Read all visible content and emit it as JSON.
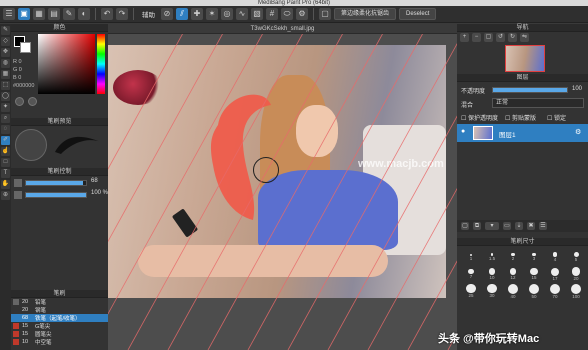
{
  "window": {
    "title": "MediBang Paint Pro (64bit)"
  },
  "toolbar": {
    "assist_label": "辅助",
    "antialias_button": "第边缘柔化抗锯齿",
    "deselect_button": "Deselect"
  },
  "document": {
    "tab_title": "T3wGKcSekh_small.jpg"
  },
  "color_panel": {
    "title": "颜色",
    "r_label": "R 0",
    "g_label": "G 0",
    "b_label": "B 0",
    "hex_label": "#000000"
  },
  "brush_preview_panel": {
    "title": "笔刷预览"
  },
  "brush_control_panel": {
    "title": "笔刷控制",
    "size_value": "68",
    "opacity_value": "100 %"
  },
  "brush_panel": {
    "title": "笔刷",
    "items": [
      {
        "size": "20",
        "name": "铅笔",
        "color": "#666666"
      },
      {
        "size": "20",
        "name": "钢笔",
        "color": "#333333"
      },
      {
        "size": "68",
        "name": "铁笔（起笔/收笔）",
        "color": "#2f7fc1",
        "selected": true
      },
      {
        "size": "15",
        "name": "G笔尖",
        "color": "#c0392b"
      },
      {
        "size": "15",
        "name": "圆笔尖",
        "color": "#c0392b"
      },
      {
        "size": "10",
        "name": "中空笔",
        "color": "#c0392b"
      }
    ]
  },
  "navigator_panel": {
    "title": "导航"
  },
  "layer_panel": {
    "title": "图层",
    "opacity_label": "不透明度",
    "opacity_value": "100",
    "blend_label": "混合",
    "blend_value": "正常",
    "protect_alpha": "保护透明度",
    "clipping": "剪贴蒙版",
    "lock": "锁定",
    "layer_name": "图层1"
  },
  "brush_size_panel": {
    "title": "笔刷尺寸",
    "sizes": [
      "1",
      "1.5",
      "2",
      "3",
      "4",
      "5",
      "7",
      "10",
      "12",
      "15",
      "17",
      "20",
      "25",
      "30",
      "40",
      "50",
      "70",
      "100"
    ]
  },
  "watermark": {
    "site": "www.macjb.com",
    "credit": "头条 @带你玩转Mac"
  },
  "colors": {
    "accent": "#2f7fc1",
    "selected_row": "#2f7fc1",
    "brush_stroke": "#f05a4a"
  }
}
